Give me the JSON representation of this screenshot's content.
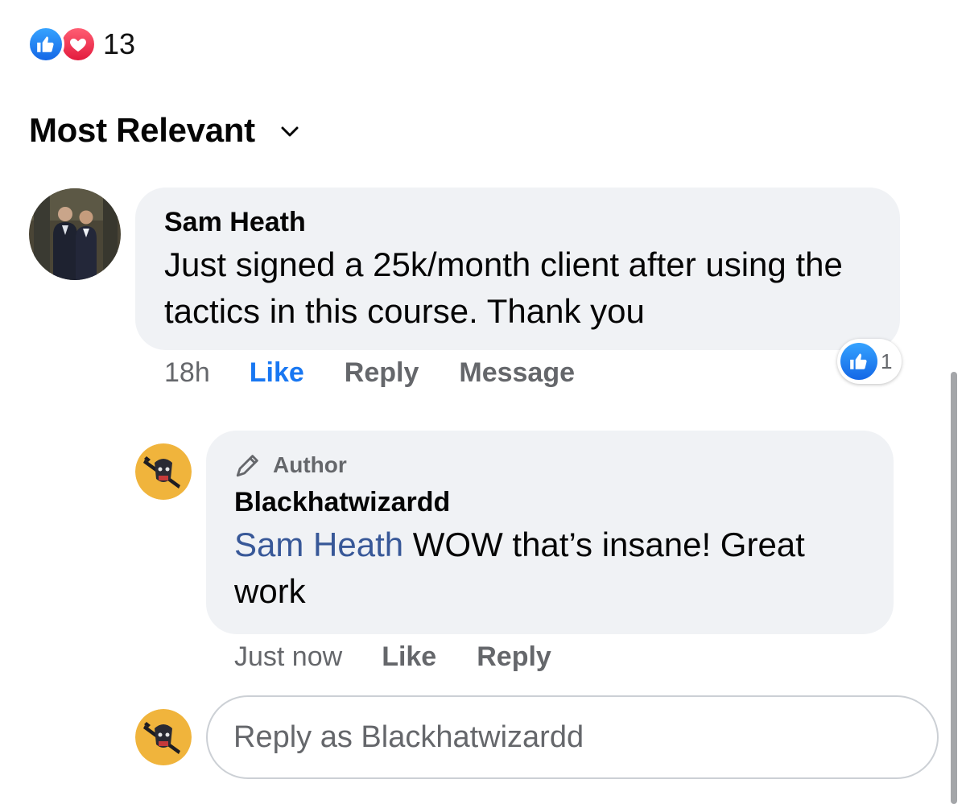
{
  "reactions": {
    "count": "13"
  },
  "sort": {
    "label": "Most Relevant"
  },
  "comments": [
    {
      "author": "Sam Heath",
      "text": "Just signed a 25k/month client after using the tactics in this course. Thank you",
      "time": "18h",
      "like_label": "Like",
      "reply_label": "Reply",
      "message_label": "Message",
      "reaction_count": "1",
      "replies": [
        {
          "badge": "Author",
          "author": "Blackhatwizardd",
          "mention": "Sam Heath",
          "text": " WOW that’s insane! Great work",
          "time": "Just now",
          "like_label": "Like",
          "reply_label": "Reply"
        }
      ]
    }
  ],
  "reply_input": {
    "placeholder": "Reply as Blackhatwizardd"
  },
  "colors": {
    "like_blue": "#1877f2",
    "love_red": "#f02849",
    "mention_blue": "#385898",
    "bubble_bg": "#f0f2f5",
    "secondary_text": "#65676b"
  },
  "icons": {
    "like": "thumbs-up-icon",
    "love": "heart-icon",
    "sort": "chevron-down-icon",
    "author": "pen-icon"
  }
}
